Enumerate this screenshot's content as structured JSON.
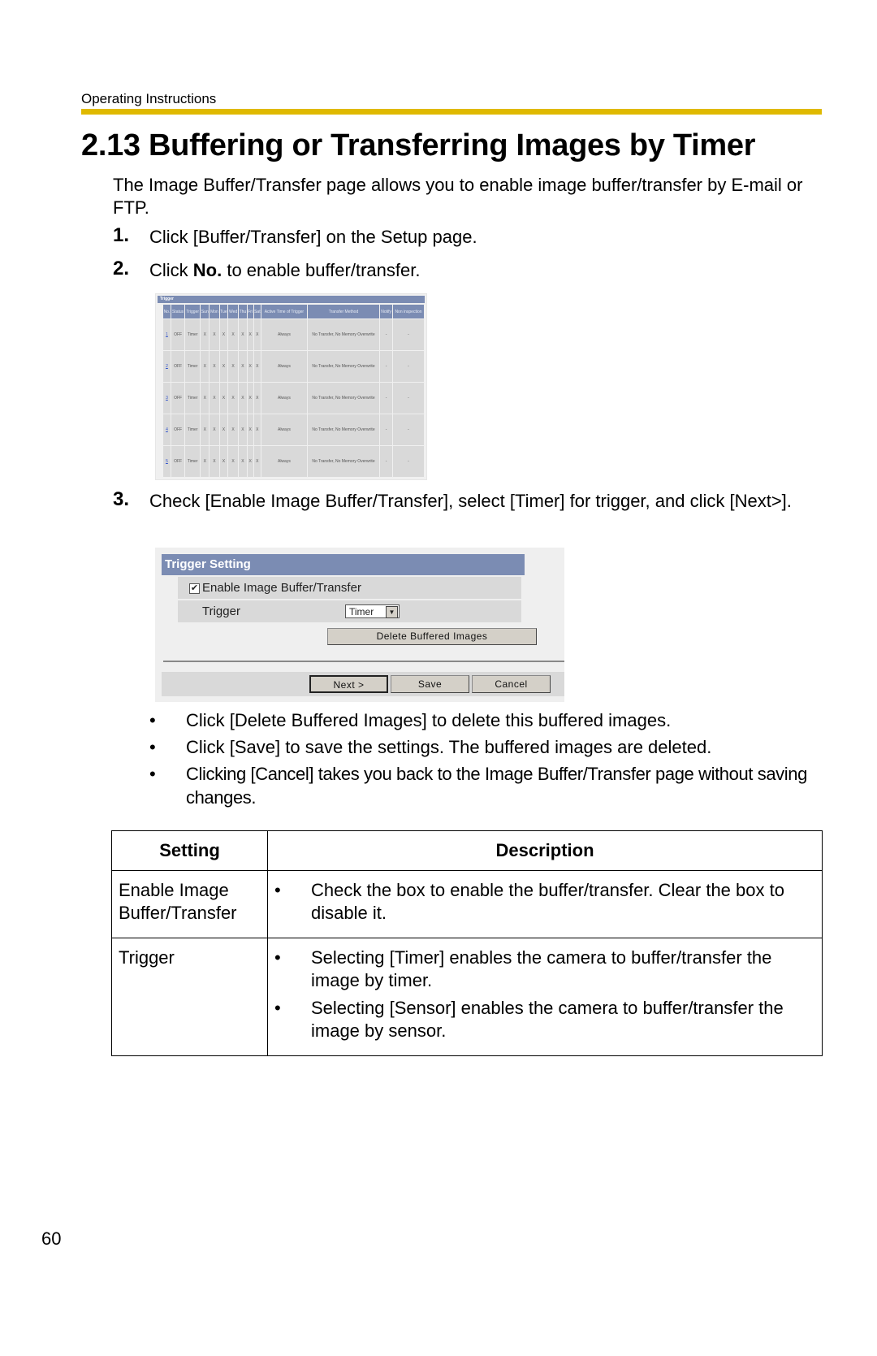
{
  "header": {
    "label": "Operating Instructions",
    "accent_color": "#dfb900"
  },
  "title": "2.13  Buffering or Transferring Images by Timer",
  "intro": "The Image Buffer/Transfer page allows you to enable image buffer/transfer by E-mail or FTP.",
  "steps": [
    {
      "num": "1.",
      "text": "Click [Buffer/Transfer] on the Setup page."
    },
    {
      "num": "2.",
      "text_before": "Click ",
      "text_bold": "No.",
      "text_after": " to enable buffer/transfer."
    },
    {
      "num": "3.",
      "text": "Check [Enable Image Buffer/Transfer], select [Timer] for trigger, and click [Next>]."
    }
  ],
  "trigger_list": {
    "title": "Trigger",
    "columns": [
      "No.",
      "Status",
      "Trigger",
      "Sun",
      "Mon",
      "Tue",
      "Wed",
      "Thu",
      "Fri",
      "Sat",
      "Active Time of Trigger",
      "Transfer Method",
      "Notify",
      "Non inspection"
    ],
    "rows": [
      {
        "no": "1",
        "status": "OFF",
        "trigger": "Timer",
        "days": [
          "X",
          "X",
          "X",
          "X",
          "X",
          "X",
          "X"
        ],
        "active": "Always",
        "method": "No Transfer, No Memory Overwrite",
        "notify": "-",
        "non": "-"
      },
      {
        "no": "2",
        "status": "OFF",
        "trigger": "Timer",
        "days": [
          "X",
          "X",
          "X",
          "X",
          "X",
          "X",
          "X"
        ],
        "active": "Always",
        "method": "No Transfer, No Memory Overwrite",
        "notify": "-",
        "non": "-"
      },
      {
        "no": "3",
        "status": "OFF",
        "trigger": "Timer",
        "days": [
          "X",
          "X",
          "X",
          "X",
          "X",
          "X",
          "X"
        ],
        "active": "Always",
        "method": "No Transfer, No Memory Overwrite",
        "notify": "-",
        "non": "-"
      },
      {
        "no": "4",
        "status": "OFF",
        "trigger": "Timer",
        "days": [
          "X",
          "X",
          "X",
          "X",
          "X",
          "X",
          "X"
        ],
        "active": "Always",
        "method": "No Transfer, No Memory Overwrite",
        "notify": "-",
        "non": "-"
      },
      {
        "no": "5",
        "status": "OFF",
        "trigger": "Timer",
        "days": [
          "X",
          "X",
          "X",
          "X",
          "X",
          "X",
          "X"
        ],
        "active": "Always",
        "method": "No Transfer, No Memory Overwrite",
        "notify": "-",
        "non": "-"
      }
    ]
  },
  "trigger_setting": {
    "title": "Trigger Setting",
    "enable_label": "Enable Image Buffer/Transfer",
    "enable_checked": true,
    "checkmark": "✔",
    "trigger_label": "Trigger",
    "trigger_value": "Timer",
    "dropdown_arrow": "▼",
    "delete_button": "Delete Buffered Images",
    "next_button": "Next >",
    "save_button": "Save",
    "cancel_button": "Cancel"
  },
  "bullets": [
    "Click [Delete Buffered Images] to delete this buffered images.",
    "Click [Save] to save the settings. The buffered images are deleted.",
    "Clicking [Cancel] takes you back to the Image Buffer/Transfer page without saving changes."
  ],
  "bullet_char": "•",
  "settings_table": {
    "headers": [
      "Setting",
      "Description"
    ],
    "rows": [
      {
        "setting": "Enable Image Buffer/Transfer",
        "items": [
          "Check the box to enable the buffer/transfer. Clear the box to disable it."
        ]
      },
      {
        "setting": "Trigger",
        "items": [
          "Selecting [Timer] enables the camera to buffer/transfer the image by timer.",
          "Selecting [Sensor] enables the camera to buffer/transfer the image by sensor."
        ]
      }
    ]
  },
  "page_number": "60"
}
